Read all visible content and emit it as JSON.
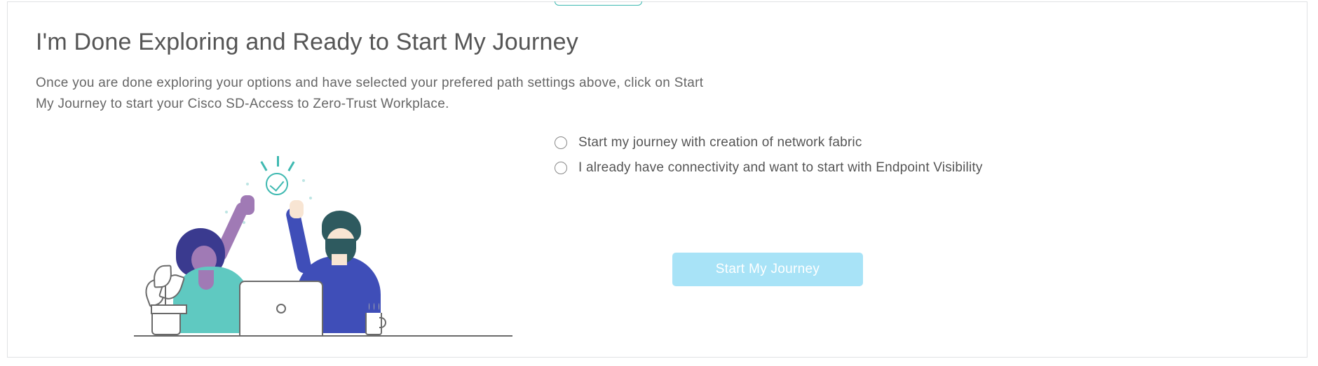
{
  "section": {
    "title": "I'm Done Exploring and Ready to Start My Journey",
    "description": "Once you are done exploring your options and have selected your prefered path settings above, click on Start My Journey to start your Cisco SD-Access to Zero-Trust Workplace."
  },
  "options": [
    {
      "label": "Start my journey with creation of network fabric",
      "selected": false
    },
    {
      "label": "I already have connectivity and want to start with Endpoint Visibility",
      "selected": false
    }
  ],
  "cta": {
    "label": "Start My Journey"
  }
}
